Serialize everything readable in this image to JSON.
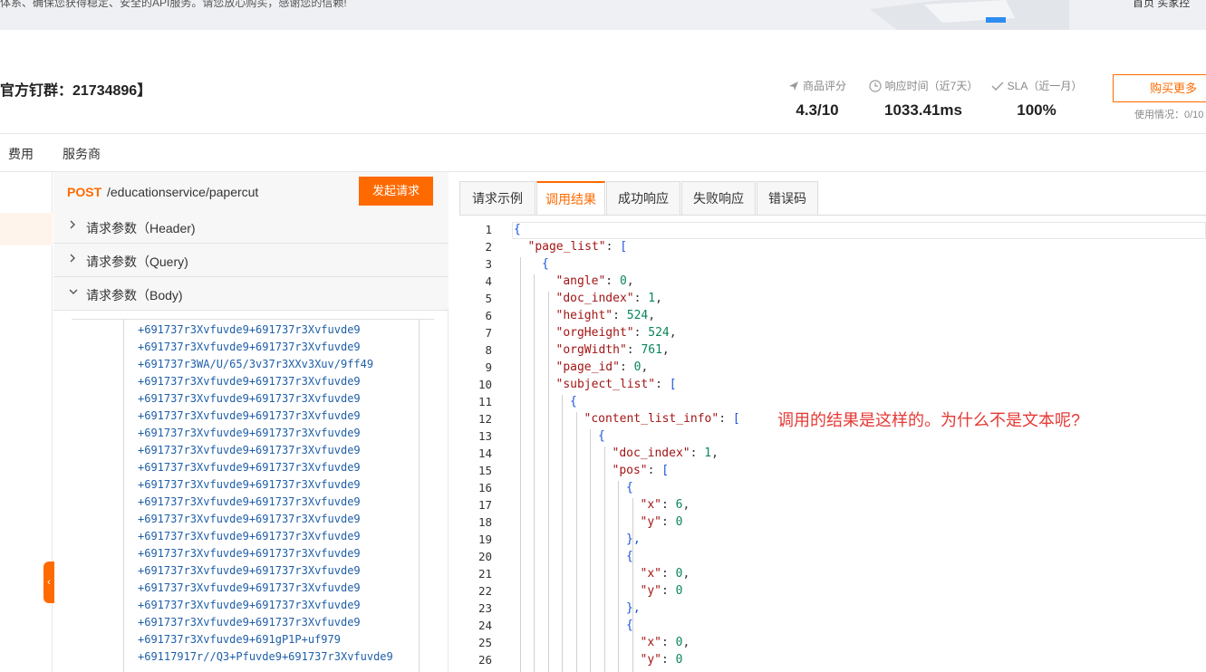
{
  "banner": {
    "text": "体系、确保您获得稳定、安全的API服务。请您放心购买，感谢您的信赖!",
    "nav": "首页  买家控"
  },
  "header": {
    "title": "官方钉群：21734896】",
    "stats": [
      {
        "label": "商品评分",
        "value": "4.3/10",
        "icon": "send-icon"
      },
      {
        "label": "响应时间（近7天）",
        "value": "1033.41ms",
        "icon": "clock-icon"
      },
      {
        "label": "SLA（近一月）",
        "value": "100%",
        "icon": "check-icon"
      }
    ],
    "buy_button": "购买更多",
    "usage": "使用情况：0/10"
  },
  "main_tabs": [
    "费用",
    "服务商"
  ],
  "request": {
    "method": "POST",
    "path": "/educationservice/papercut",
    "send_button": "发起请求",
    "sections": [
      {
        "label": "请求参数（Header)",
        "expanded": false
      },
      {
        "label": "请求参数（Query)",
        "expanded": false
      },
      {
        "label": "请求参数（Body)",
        "expanded": true
      }
    ],
    "body_lines": [
      "+691737r3Xvfuvde9+691737r3Xvfuvde9",
      "+691737r3Xvfuvde9+691737r3Xvfuvde9",
      "+691737r3WA/U/65/3v37r3XXv3Xuv/9ff49",
      "+691737r3Xvfuvde9+691737r3Xvfuvde9",
      "+691737r3Xvfuvde9+691737r3Xvfuvde9",
      "+691737r3Xvfuvde9+691737r3Xvfuvde9",
      "+691737r3Xvfuvde9+691737r3Xvfuvde9",
      "+691737r3Xvfuvde9+691737r3Xvfuvde9",
      "+691737r3Xvfuvde9+691737r3Xvfuvde9",
      "+691737r3Xvfuvde9+691737r3Xvfuvde9",
      "+691737r3Xvfuvde9+691737r3Xvfuvde9",
      "+691737r3Xvfuvde9+691737r3Xvfuvde9",
      "+691737r3Xvfuvde9+691737r3Xvfuvde9",
      "+691737r3Xvfuvde9+691737r3Xvfuvde9",
      "+691737r3Xvfuvde9+691737r3Xvfuvde9",
      "+691737r3Xvfuvde9+691737r3Xvfuvde9",
      "+691737r3Xvfuvde9+691737r3Xvfuvde9",
      "+691737r3Xvfuvde9+691737r3Xvfuvde9",
      "+691737r3Xvfuvde9+691gP1P+uf979",
      "+69117917r//Q3+Pfuvde9+691737r3Xvfuvde9"
    ]
  },
  "result": {
    "tabs": [
      "请求示例",
      "调用结果",
      "成功响应",
      "失败响应",
      "错误码"
    ],
    "active_tab": 1,
    "line_numbers": [
      "1",
      "2",
      "3",
      "4",
      "5",
      "6",
      "7",
      "8",
      "9",
      "10",
      "11",
      "12",
      "13",
      "14",
      "15",
      "16",
      "17",
      "18",
      "19",
      "20",
      "21",
      "22",
      "23",
      "24",
      "25",
      "26"
    ],
    "code": [
      {
        "key": "",
        "val": "{",
        "type": "brace"
      },
      {
        "key": "\"page_list\"",
        "val": "[",
        "type": "brace"
      },
      {
        "key": "",
        "val": "{",
        "type": "brace"
      },
      {
        "key": "\"angle\"",
        "val": "0",
        "type": "num",
        "comma": true
      },
      {
        "key": "\"doc_index\"",
        "val": "1",
        "type": "num",
        "comma": true
      },
      {
        "key": "\"height\"",
        "val": "524",
        "type": "num",
        "comma": true
      },
      {
        "key": "\"orgHeight\"",
        "val": "524",
        "type": "num",
        "comma": true
      },
      {
        "key": "\"orgWidth\"",
        "val": "761",
        "type": "num",
        "comma": true
      },
      {
        "key": "\"page_id\"",
        "val": "0",
        "type": "num",
        "comma": true
      },
      {
        "key": "\"subject_list\"",
        "val": "[",
        "type": "brace"
      },
      {
        "key": "",
        "val": "{",
        "type": "brace"
      },
      {
        "key": "\"content_list_info\"",
        "val": "[",
        "type": "brace"
      },
      {
        "key": "",
        "val": "{",
        "type": "brace"
      },
      {
        "key": "\"doc_index\"",
        "val": "1",
        "type": "num",
        "comma": true
      },
      {
        "key": "\"pos\"",
        "val": "[",
        "type": "brace"
      },
      {
        "key": "",
        "val": "{",
        "type": "brace"
      },
      {
        "key": "\"x\"",
        "val": "6",
        "type": "num",
        "comma": true
      },
      {
        "key": "\"y\"",
        "val": "0",
        "type": "num",
        "comma": false
      },
      {
        "key": "",
        "val": "},",
        "type": "brace"
      },
      {
        "key": "",
        "val": "{",
        "type": "brace"
      },
      {
        "key": "\"x\"",
        "val": "0",
        "type": "num",
        "comma": true
      },
      {
        "key": "\"y\"",
        "val": "0",
        "type": "num",
        "comma": false
      },
      {
        "key": "",
        "val": "},",
        "type": "brace"
      },
      {
        "key": "",
        "val": "{",
        "type": "brace"
      },
      {
        "key": "\"x\"",
        "val": "0",
        "type": "num",
        "comma": true
      },
      {
        "key": "\"y\"",
        "val": "0",
        "type": "num",
        "comma": false
      }
    ]
  },
  "annotation": "调用的结果是这样的。为什么不是文本呢?",
  "colors": {
    "accent": "#ff6a00",
    "annotation": "#e53935",
    "json_key": "#a31515",
    "json_number": "#098658"
  }
}
